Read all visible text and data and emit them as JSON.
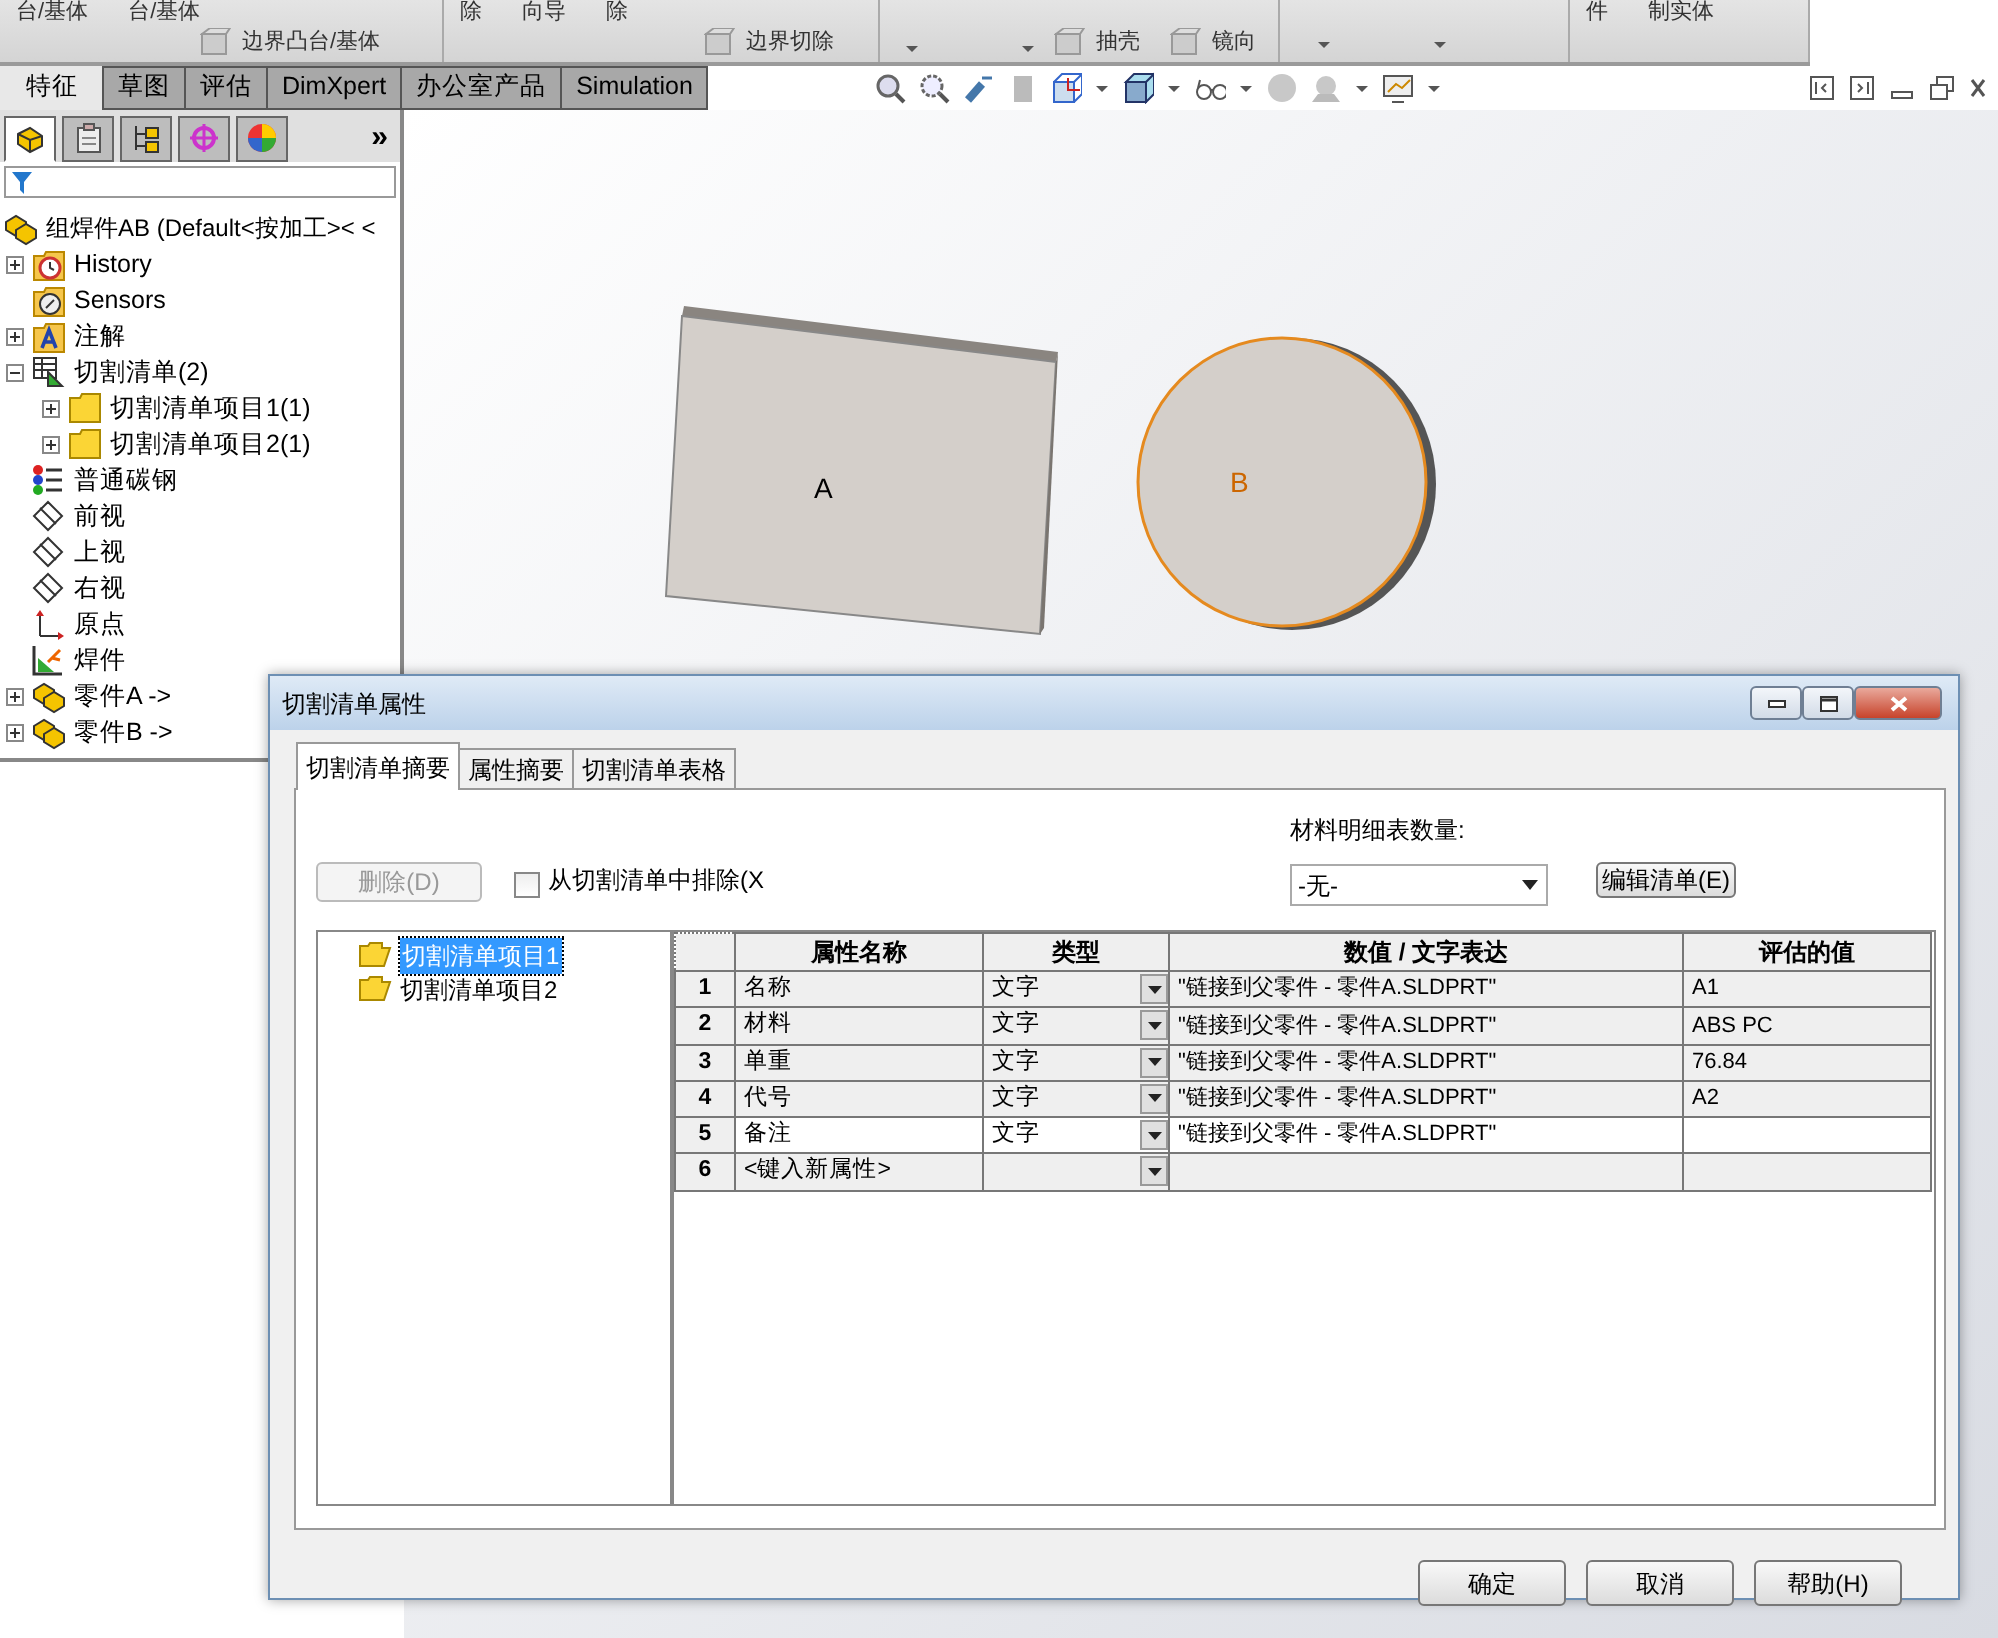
{
  "ribbon": {
    "groups": [
      {
        "top": [
          "台/基体",
          "台/基体"
        ],
        "bottom": [
          {
            "kind": "icon-text",
            "label": "边界凸台/基体"
          }
        ]
      },
      {
        "top": [
          "除",
          "向导",
          "除"
        ],
        "bottom": [
          {
            "kind": "icon-text",
            "label": "边界切除"
          }
        ]
      },
      {
        "bottom": [
          {
            "kind": "caret"
          },
          {
            "kind": "caret"
          },
          {
            "kind": "icon-text",
            "label": "抽壳"
          },
          {
            "kind": "icon-text",
            "label": "镜向"
          }
        ]
      },
      {
        "bottom": [
          {
            "kind": "caret"
          },
          {
            "kind": "caret"
          }
        ]
      },
      {
        "top": [
          "件",
          "制实体"
        ]
      }
    ]
  },
  "command_tabs": [
    {
      "label": "特征",
      "selected": true
    },
    {
      "label": "草图",
      "selected": false
    },
    {
      "label": "评估",
      "selected": false
    },
    {
      "label": "DimXpert",
      "selected": false
    },
    {
      "label": "办公室产品",
      "selected": false
    },
    {
      "label": "Simulation",
      "selected": false
    }
  ],
  "panel_tabs": [
    {
      "kind": "feature",
      "selected": true
    },
    {
      "kind": "property",
      "selected": false
    },
    {
      "kind": "config",
      "selected": false
    },
    {
      "kind": "dimxpert",
      "selected": false
    },
    {
      "kind": "display",
      "selected": false
    }
  ],
  "panel_more": "»",
  "tree": {
    "label": "组焊件AB (Default<按加工>< <",
    "kind": "part",
    "children": [
      {
        "label": "History",
        "kind": "history",
        "expanded": false
      },
      {
        "label": "Sensors",
        "kind": "sensors"
      },
      {
        "label": "注解",
        "kind": "annotations",
        "expanded": false
      },
      {
        "label": "切割清单(2)",
        "kind": "cutlist",
        "expanded": true,
        "children": [
          {
            "label": "切割清单项目1(1)",
            "kind": "folder",
            "expanded": false
          },
          {
            "label": "切割清单项目2(1)",
            "kind": "folder",
            "expanded": false
          }
        ]
      },
      {
        "label": "普通碳钢",
        "kind": "material"
      },
      {
        "label": "前视",
        "kind": "plane"
      },
      {
        "label": "上视",
        "kind": "plane"
      },
      {
        "label": "右视",
        "kind": "plane"
      },
      {
        "label": "原点",
        "kind": "origin"
      },
      {
        "label": "焊件",
        "kind": "weldment"
      },
      {
        "label": "零件A ->",
        "kind": "part",
        "expanded": false
      },
      {
        "label": "零件B ->",
        "kind": "part",
        "expanded": false
      }
    ]
  },
  "viewport": {
    "labels": [
      "A",
      "B"
    ]
  },
  "dialog": {
    "title": "切割清单属性",
    "tabs": [
      {
        "label": "切割清单摘要",
        "selected": true
      },
      {
        "label": "属性摘要",
        "selected": false
      },
      {
        "label": "切割清单表格",
        "selected": false
      }
    ],
    "delete_button": {
      "label": "删除(D)",
      "disabled": true
    },
    "exclude": {
      "label": "从切割清单中排除(X",
      "checked": false
    },
    "bom_label": "材料明细表数量:",
    "bom_select": "-无-",
    "edit_button": "编辑清单(E)",
    "items": [
      {
        "label": "切割清单项目1",
        "selected": true
      },
      {
        "label": "切割清单项目2",
        "selected": false
      }
    ],
    "columns": [
      "属性名称",
      "类型",
      "数值 / 文字表达",
      "评估的值"
    ],
    "rows": [
      {
        "num": "1",
        "name": "名称",
        "type": "文字",
        "value": "\"链接到父零件 - 零件A.SLDPRT\"",
        "evaluated": "A1",
        "selected": false
      },
      {
        "num": "2",
        "name": "材料",
        "type": "文字",
        "value": "\"链接到父零件 - 零件A.SLDPRT\"",
        "evaluated": "ABS PC",
        "selected": false
      },
      {
        "num": "3",
        "name": "单重",
        "type": "文字",
        "value": "\"链接到父零件 - 零件A.SLDPRT\"",
        "evaluated": "76.84",
        "selected": false
      },
      {
        "num": "4",
        "name": "代号",
        "type": "文字",
        "value": "\"链接到父零件 - 零件A.SLDPRT\"",
        "evaluated": "A2",
        "selected": false
      },
      {
        "num": "5",
        "name": "备注",
        "type": "文字",
        "value": "\"链接到父零件 - 零件A.SLDPRT\"",
        "selected": true
      },
      {
        "num": "6",
        "name": "<键入新属性>",
        "selected": false
      }
    ],
    "buttons": [
      "确定",
      "取消",
      "帮助(H)"
    ]
  }
}
